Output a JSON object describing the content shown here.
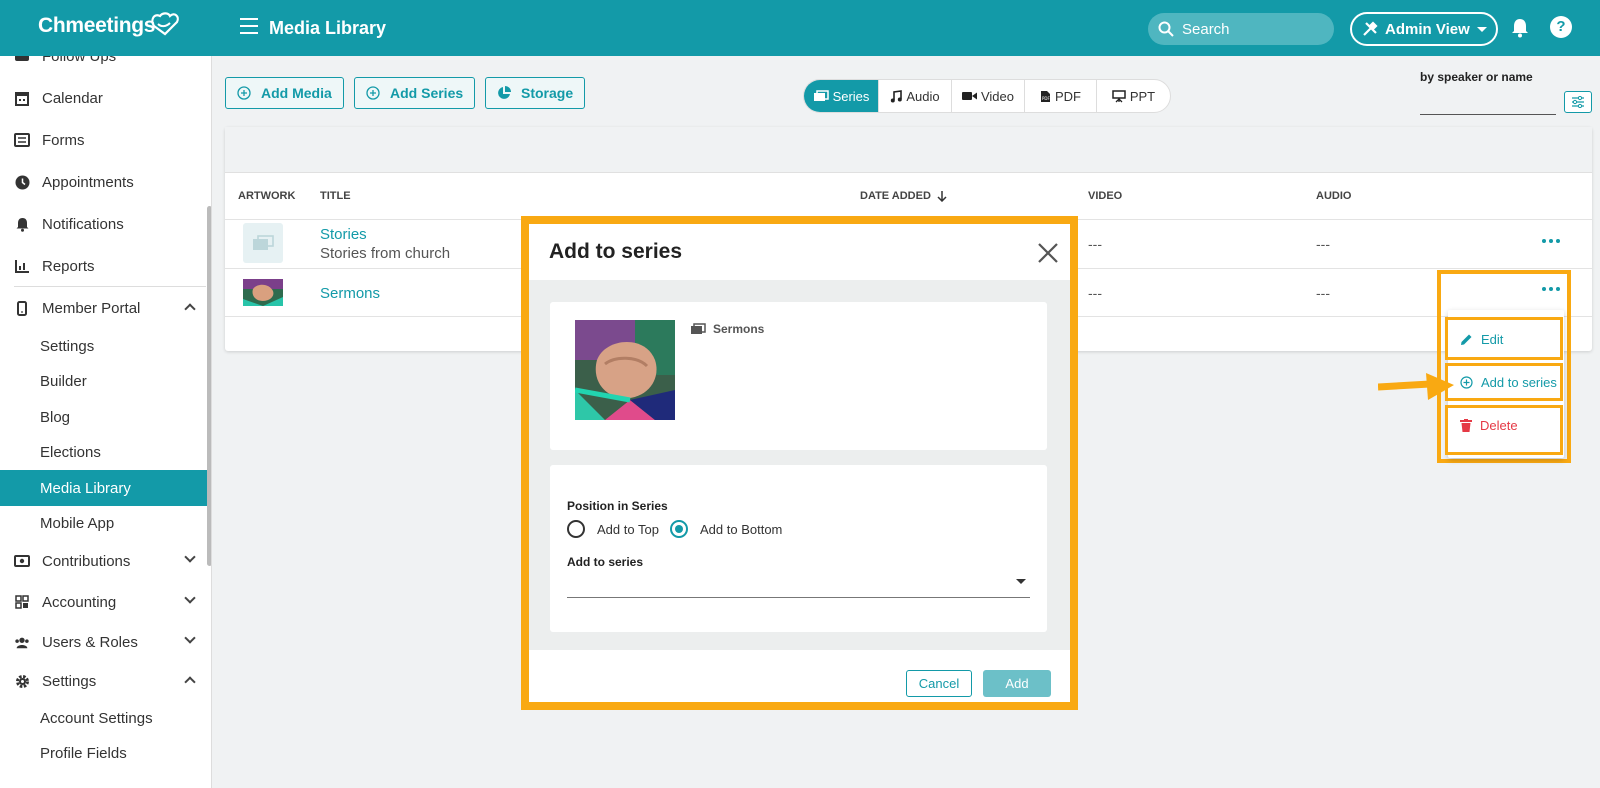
{
  "header": {
    "brand": "Chmeetings",
    "title": "Media Library",
    "search_label": "Search",
    "admin_view_label": "Admin View"
  },
  "sidebar": {
    "items": [
      {
        "label": "Follow Ups",
        "icon": "followups-icon"
      },
      {
        "label": "Calendar",
        "icon": "calendar-icon"
      },
      {
        "label": "Forms",
        "icon": "list-icon"
      },
      {
        "label": "Appointments",
        "icon": "clock-icon"
      },
      {
        "label": "Notifications",
        "icon": "bell-icon"
      },
      {
        "label": "Reports",
        "icon": "chart-icon"
      },
      {
        "label": "Member Portal",
        "icon": "phone-icon"
      }
    ],
    "member_portal_sub": [
      "Settings",
      "Builder",
      "Blog",
      "Elections",
      "Media Library",
      "Mobile App"
    ],
    "groups": [
      {
        "label": "Contributions",
        "icon": "money-icon"
      },
      {
        "label": "Accounting",
        "icon": "grid-icon"
      },
      {
        "label": "Users & Roles",
        "icon": "users-icon"
      },
      {
        "label": "Settings",
        "icon": "gear-icon"
      }
    ],
    "settings_sub": [
      "Account Settings",
      "Profile Fields"
    ]
  },
  "toolbar": {
    "add_media": "Add Media",
    "add_series": "Add Series",
    "storage": "Storage",
    "tabs": [
      "Series",
      "Audio",
      "Video",
      "PDF",
      "PPT"
    ],
    "active_tab": "Series",
    "filter_label": "by speaker or name"
  },
  "table": {
    "columns": [
      "ARTWORK",
      "TITLE",
      "DATE ADDED",
      "VIDEO",
      "AUDIO"
    ],
    "rows": [
      {
        "title": "Stories",
        "subtitle": "Stories from church",
        "video": "---",
        "audio": "---"
      },
      {
        "title": "Sermons",
        "subtitle": "",
        "video": "---",
        "audio": "---"
      }
    ]
  },
  "row_menu": {
    "edit": "Edit",
    "add_to_series": "Add to series",
    "delete": "Delete"
  },
  "modal": {
    "title": "Add to series",
    "series_name": "Sermons",
    "position_label": "Position in Series",
    "option_top": "Add to Top",
    "option_bottom": "Add to Bottom",
    "selected_position": "Add to Bottom",
    "select_label": "Add to series",
    "cancel": "Cancel",
    "add": "Add"
  },
  "colors": {
    "brand": "#139aa8",
    "highlight": "#f9a912",
    "danger": "#e53945"
  }
}
